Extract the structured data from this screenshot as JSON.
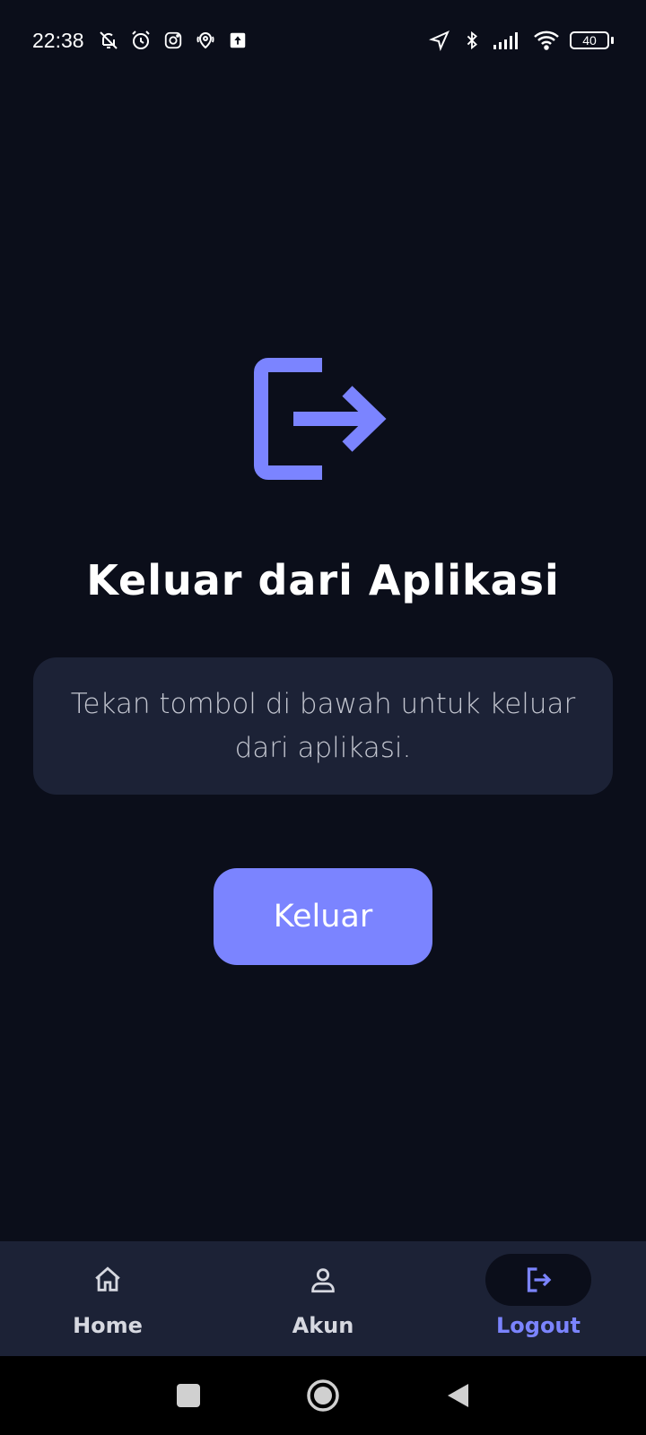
{
  "status_bar": {
    "time": "22:38",
    "battery_level": "40",
    "left_icons": [
      "bell-off-icon",
      "alarm-icon",
      "instagram-icon",
      "location-pin-icon",
      "upload-icon"
    ],
    "right_icons": [
      "navigation-icon",
      "bluetooth-icon",
      "signal-icon",
      "wifi-icon",
      "battery-icon"
    ]
  },
  "main": {
    "icon": "logout-icon",
    "title": "Keluar dari Aplikasi",
    "message": "Tekan tombol di bawah untuk keluar dari aplikasi.",
    "button_label": "Keluar"
  },
  "bottom_nav": {
    "items": [
      {
        "label": "Home",
        "icon": "home-icon",
        "active": false
      },
      {
        "label": "Akun",
        "icon": "user-icon",
        "active": false
      },
      {
        "label": "Logout",
        "icon": "logout-icon",
        "active": true
      }
    ]
  },
  "system_nav": [
    "recents-button",
    "home-button",
    "back-button"
  ],
  "colors": {
    "background": "#0b0e1a",
    "card": "#1c2236",
    "accent": "#7b84ff",
    "text": "#ffffff",
    "muted_text": "#c2c5cf"
  }
}
